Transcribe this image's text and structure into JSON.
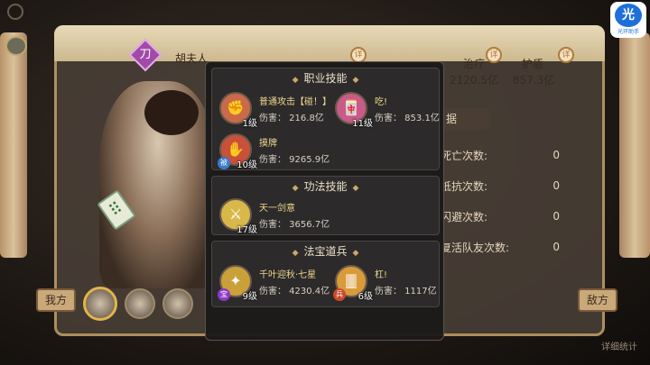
{
  "top_logo": "",
  "brand_badge": {
    "glyph": "光",
    "text": "光环助手"
  },
  "character": {
    "icon_glyph": "刀",
    "name": "胡夫人"
  },
  "stats": [
    {
      "label": "",
      "value": ""
    },
    {
      "label": "",
      "value": ""
    },
    {
      "label": "治疗",
      "value": "2120.5亿"
    },
    {
      "label": "护盾",
      "value": "857.3亿"
    }
  ],
  "right_panel": {
    "tab": "据",
    "rows": [
      {
        "label": "死亡次数:",
        "value": "0"
      },
      {
        "label": "抵抗次数:",
        "value": "0"
      },
      {
        "label": "闪避次数:",
        "value": "0"
      },
      {
        "label": "复活队友次数:",
        "value": "0"
      }
    ]
  },
  "bottom": {
    "ally_button": "我方",
    "enemy_button": "敌方",
    "detail_stats": "详细统计"
  },
  "popup": {
    "sections": [
      {
        "title": "职业技能",
        "skills": [
          {
            "name": "普通攻击【碰！】",
            "level": "1级",
            "badge": "",
            "damage": "伤害： 216.8亿",
            "color": "#c96a4a"
          },
          {
            "name": "吃!",
            "level": "11级",
            "badge": "",
            "damage": "伤害： 853.1亿",
            "color": "#c95a8a"
          },
          {
            "name": "摸牌",
            "level": "10级",
            "badge": "被",
            "damage": "伤害： 9265.9亿",
            "color": "#c9503a"
          }
        ]
      },
      {
        "title": "功法技能",
        "skills": [
          {
            "name": "天一剑意",
            "level": "17级",
            "badge": "",
            "damage": "伤害： 3656.7亿",
            "color": "#d9b84a"
          }
        ]
      },
      {
        "title": "法宝道兵",
        "skills": [
          {
            "name": "千叶迎秋·七星",
            "level": "9级",
            "badge": "宝",
            "damage": "伤害： 4230.4亿",
            "color": "#c9a03a"
          },
          {
            "name": "杠!",
            "level": "6级",
            "badge": "兵",
            "damage": "伤害： 1117亿",
            "color": "#d99a3a"
          }
        ]
      }
    ]
  }
}
